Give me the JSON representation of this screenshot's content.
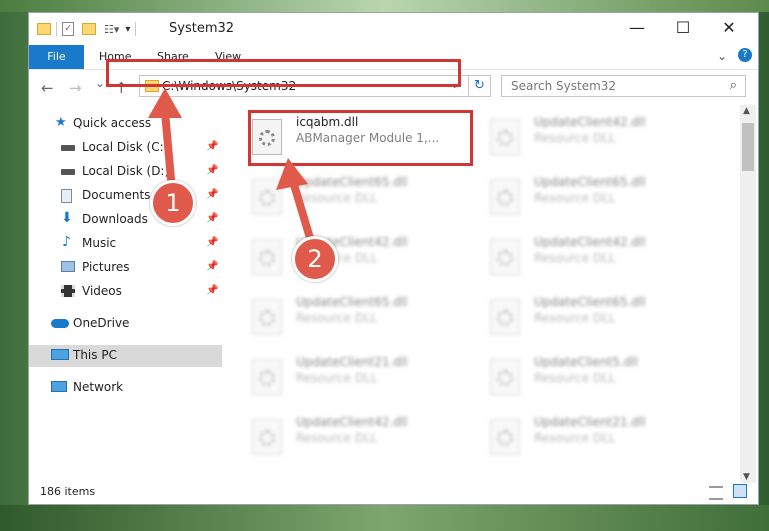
{
  "window": {
    "title": "System32",
    "controls": {
      "minimize": "—",
      "maximize": "☐",
      "close": "✕"
    }
  },
  "ribbon": {
    "tabs": [
      "File",
      "Home",
      "Share",
      "View"
    ],
    "collapse_icon": "chevron-down-icon",
    "help_icon": "help-icon"
  },
  "nav": {
    "back_icon": "←",
    "forward_icon": "→",
    "recent_icon": "⌄",
    "up_icon": "↑",
    "address": "C:\\Windows\\System32",
    "search_placeholder": "Search System32"
  },
  "sidebar": {
    "items": [
      {
        "label": "Quick access",
        "icon": "star-icon",
        "pinned": false
      },
      {
        "label": "Local Disk (C:)",
        "icon": "drive-icon",
        "pinned": true
      },
      {
        "label": "Local Disk (D:)",
        "icon": "drive-icon",
        "pinned": true
      },
      {
        "label": "Documents",
        "icon": "documents-icon",
        "pinned": true
      },
      {
        "label": "Downloads",
        "icon": "downloads-icon",
        "pinned": true
      },
      {
        "label": "Music",
        "icon": "music-icon",
        "pinned": true
      },
      {
        "label": "Pictures",
        "icon": "pictures-icon",
        "pinned": true
      },
      {
        "label": "Videos",
        "icon": "videos-icon",
        "pinned": true
      },
      {
        "label": "OneDrive",
        "icon": "cloud-icon",
        "pinned": false
      },
      {
        "label": "This PC",
        "icon": "computer-icon",
        "pinned": false,
        "selected": true
      },
      {
        "label": "Network",
        "icon": "network-icon",
        "pinned": false
      }
    ]
  },
  "files": {
    "highlighted": {
      "name": "icqabm.dll",
      "desc": "ABManager Module 1,..."
    },
    "items": [
      {
        "name": "UpdateClient42.dll",
        "desc": "Resource DLL"
      },
      {
        "name": "UpdateClient65.dll",
        "desc": "Resource DLL"
      },
      {
        "name": "UpdateClient65.dll",
        "desc": "Resource DLL"
      },
      {
        "name": "UpdateClient42.dll",
        "desc": "Resource DLL"
      },
      {
        "name": "UpdateClient42.dll",
        "desc": "Resource DLL"
      },
      {
        "name": "UpdateClient65.dll",
        "desc": "Resource DLL"
      },
      {
        "name": "UpdateClient65.dll",
        "desc": "Resource DLL"
      },
      {
        "name": "UpdateClient21.dll",
        "desc": "Resource DLL"
      },
      {
        "name": "UpdateClient5.dll",
        "desc": "Resource DLL"
      },
      {
        "name": "UpdateClient42.dll",
        "desc": "Resource DLL"
      },
      {
        "name": "UpdateClient21.dll",
        "desc": "Resource DLL"
      }
    ]
  },
  "status": {
    "item_count": "186 items"
  },
  "annotations": {
    "callout1": "1",
    "callout2": "2",
    "highlight_color": "#d03636",
    "callout_color": "#e05a4c"
  }
}
